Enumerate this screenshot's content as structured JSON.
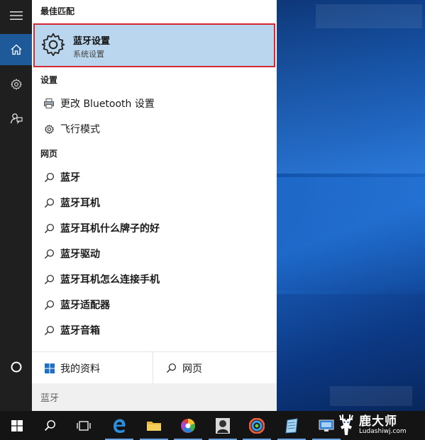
{
  "rail": {
    "items": [
      {
        "name": "hamburger-menu-icon"
      },
      {
        "name": "home-icon"
      },
      {
        "name": "gear-icon"
      },
      {
        "name": "feedback-icon"
      },
      {
        "name": "cortana-circle-icon"
      }
    ]
  },
  "panel": {
    "best_match_header": "最佳匹配",
    "best_match": {
      "title": "蓝牙设置",
      "subtitle": "系统设置",
      "icon": "gear-icon"
    },
    "settings_header": "设置",
    "settings_items": [
      {
        "label": "更改 Bluetooth 设置",
        "icon": "printer-icon"
      },
      {
        "label": "飞行模式",
        "icon": "gear-icon"
      }
    ],
    "web_header": "网页",
    "web_items": [
      "蓝牙",
      "蓝牙耳机",
      "蓝牙耳机什么牌子的好",
      "蓝牙驱动",
      "蓝牙耳机怎么连接手机",
      "蓝牙适配器",
      "蓝牙音箱"
    ],
    "my_stuff_label": "我的资料",
    "web_label": "网页",
    "search_text": "蓝牙"
  },
  "taskbar": {
    "items": [
      "windows-start-icon",
      "search-icon",
      "task-view-icon",
      "edge-icon",
      "file-explorer-icon",
      "color-wheel-app-icon",
      "photo-app-icon",
      "color-picker-app-icon",
      "notepad-app-icon",
      "remote-app-icon"
    ]
  },
  "watermark": {
    "cn": "鹿大师",
    "en": "Ludashiwj.com"
  },
  "colors": {
    "accent": "#1e5a99",
    "highlight": "#b9d6ee",
    "highlight_border": "#d32935",
    "rail": "#1f1f1f",
    "taskbar": "#141414"
  }
}
